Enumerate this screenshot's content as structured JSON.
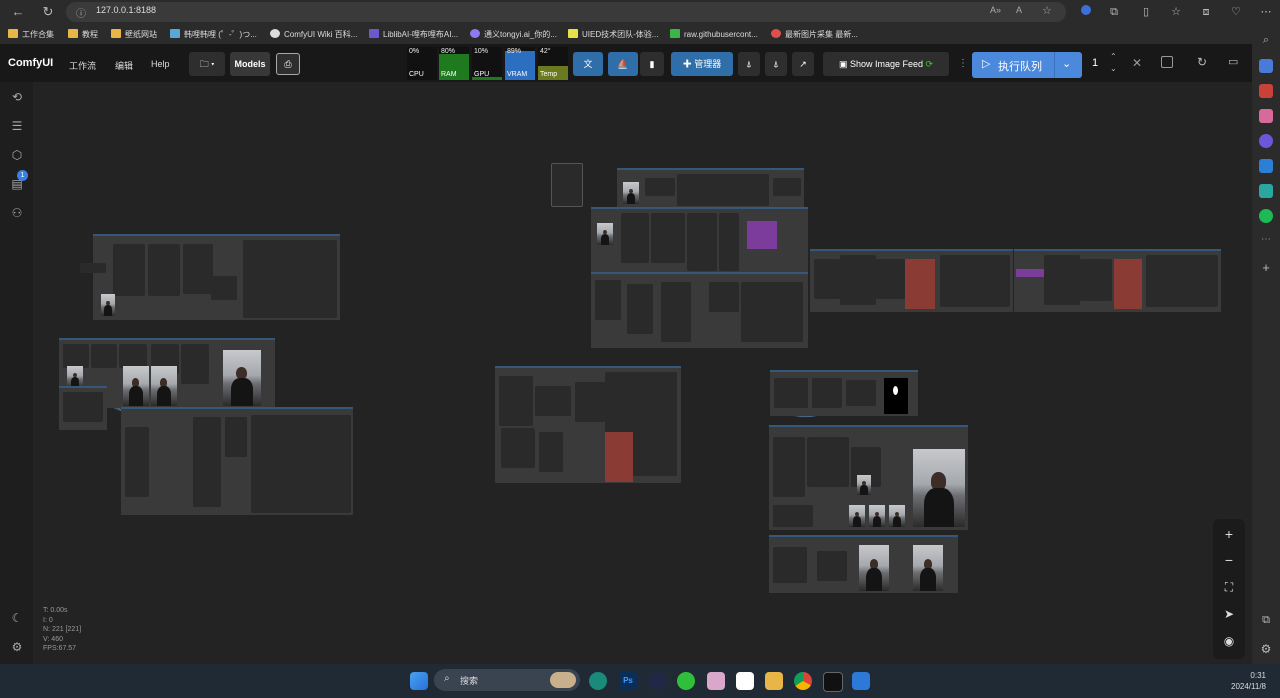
{
  "browser": {
    "url": "127.0.0.1:8188",
    "bookmarks": [
      "工作合集",
      "教程",
      "壁纸网站",
      "韩哩韩哩 (゜-゜)つ...",
      "ComfyUI Wiki 百科...",
      "LiblibAI-哩布哩布AI...",
      "通义tongyi.ai_你的...",
      "UIED技术团队-体验...",
      "raw.githubusercont...",
      "最新图片采集 最新..."
    ]
  },
  "menu": {
    "logo": "ComfyUI",
    "workflow": "工作流",
    "edit": "编辑",
    "help": "Help",
    "models": "Models"
  },
  "monitors": [
    {
      "label": "CPU",
      "value": "0%",
      "level": 0.0,
      "color": "#1d5e1d"
    },
    {
      "label": "RAM",
      "value": "80%",
      "level": 0.8,
      "color": "#1f7a1f"
    },
    {
      "label": "GPU",
      "value": "10%",
      "level": 0.1,
      "color": "#1f7a1f"
    },
    {
      "label": "VRAM",
      "value": "89%",
      "level": 0.89,
      "color": "#2c6fc0"
    },
    {
      "label": "Temp",
      "value": "42°",
      "level": 0.42,
      "color": "#6b7a1f"
    }
  ],
  "toolbar": {
    "manager": "管理器",
    "image_feed": "Show Image Feed",
    "queue": "执行队列",
    "batch_count": "1"
  },
  "sidebar": {
    "queue_badge": "1"
  },
  "stats": [
    "T: 0.00s",
    "I: 0",
    "N: 221 [221]",
    "V: 460",
    "FPS:67.57"
  ],
  "taskbar": {
    "search": "搜索",
    "time": "0:31",
    "date": "2024/11/8"
  }
}
